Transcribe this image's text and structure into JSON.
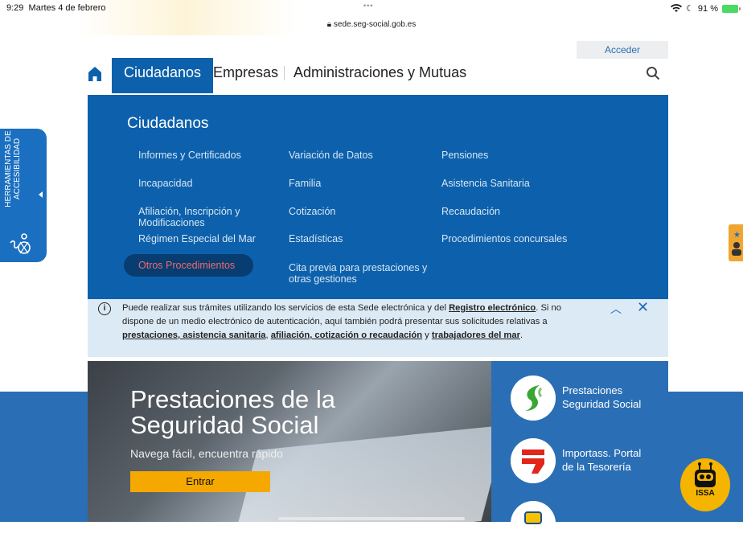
{
  "status_bar": {
    "time": "9:29",
    "date": "Martes 4 de febrero",
    "url": "sede.seg-social.gob.es",
    "battery": "91 %"
  },
  "header": {
    "login_label": "Acceder"
  },
  "nav": {
    "tabs": [
      "Ciudadanos",
      "Empresas",
      "Administraciones y Mutuas"
    ]
  },
  "menu": {
    "title": "Ciudadanos",
    "col1": [
      "Informes y Certificados",
      "Incapacidad",
      "Afiliación, Inscripción y Modificaciones",
      "Régimen Especial del Mar"
    ],
    "col2": [
      "Variación de Datos",
      "Familia",
      "Cotización",
      "Estadísticas",
      "Cita previa para prestaciones y otras gestiones"
    ],
    "col3": [
      "Pensiones",
      "Asistencia Sanitaria",
      "Recaudación",
      "Procedimientos concursales"
    ],
    "highlighted": "Otros Procedimientos"
  },
  "notice": {
    "t1": "Puede realizar sus trámites utilizando los servicios de esta Sede electrónica y del ",
    "link1": "Registro electrónico",
    "t2": ". Si no dispone de un medio electrónico de autenticación, aquí también podrá presentar sus solicitudes relativas a ",
    "link2": "prestaciones, asistencia sanitaria",
    "t3": ", ",
    "link3": "afiliación, cotización o recaudación",
    "t4": " y ",
    "link4": "trabajadores del mar",
    "t5": "."
  },
  "hero": {
    "title_line1": "Prestaciones de la",
    "title_line2": "Seguridad Social",
    "subtitle": "Navega fácil, encuentra rápido",
    "button": "Entrar"
  },
  "services": [
    {
      "line1": "Prestaciones",
      "line2": "Seguridad Social"
    },
    {
      "line1": "Importass. Portal",
      "line2": "de la Tesorería"
    }
  ],
  "accessibility": {
    "line1": "HERRAMIENTAS DE",
    "line2": "ACCESIBILIDAD"
  },
  "assistant": {
    "label": "ISSA"
  },
  "colors": {
    "primary": "#0d61ac",
    "band": "#2a6fb5",
    "accent": "#f5a800",
    "notice_bg": "#dceaf5",
    "highlight_text": "#f06a6a"
  }
}
